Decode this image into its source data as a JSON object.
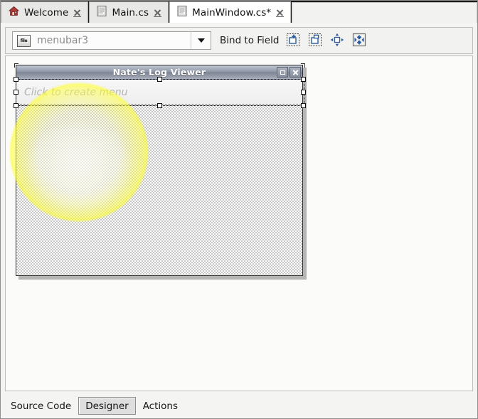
{
  "window": {
    "editor_tabs": [
      {
        "label": "Welcome",
        "icon": "home-icon",
        "active": false,
        "closable": true
      },
      {
        "label": "Main.cs",
        "icon": "document-icon",
        "active": false,
        "closable": true
      },
      {
        "label": "MainWindow.cs*",
        "icon": "document-icon",
        "active": true,
        "closable": true
      }
    ]
  },
  "toolbar": {
    "widget_selector": {
      "value": "menubar3",
      "placeholder": "menubar3",
      "icon": "file-icon",
      "dropdown_icon": "chevron-down-icon"
    },
    "bind_to_field_label": "Bind to Field",
    "buttons": [
      {
        "name": "add-container-button",
        "icon": "add-container-icon",
        "tooltip": "Add Container"
      },
      {
        "name": "remove-container-button",
        "icon": "remove-container-icon",
        "tooltip": "Remove Container"
      },
      {
        "name": "move-widget-button",
        "icon": "move-arrows-icon",
        "tooltip": "Move Widget"
      },
      {
        "name": "edit-layout-button",
        "icon": "layout-diamond-icon",
        "tooltip": "Edit Layout"
      }
    ]
  },
  "designer": {
    "form": {
      "title": "Nate's Log Viewer",
      "window_buttons": [
        {
          "name": "maximize-button",
          "icon": "maximize-icon"
        },
        {
          "name": "close-button",
          "icon": "close-icon"
        }
      ],
      "menubar_placeholder": "Click to create menu",
      "selected_widget": "menubar3"
    }
  },
  "bottom_tabs": [
    {
      "label": "Source Code",
      "selected": false
    },
    {
      "label": "Designer",
      "selected": true
    },
    {
      "label": "Actions",
      "selected": false
    }
  ],
  "colors": {
    "tabstrip_background": "#1b1b1b",
    "active_tab": "#ffffff",
    "inactive_tab": "#e8e8e6",
    "toolbar_background": "#f2f2f0",
    "canvas_background": "#fbfbfa",
    "form_titlebar": "#8d94a4",
    "highlight": "#ffff00",
    "placeholder_text": "#b3b3b1"
  }
}
